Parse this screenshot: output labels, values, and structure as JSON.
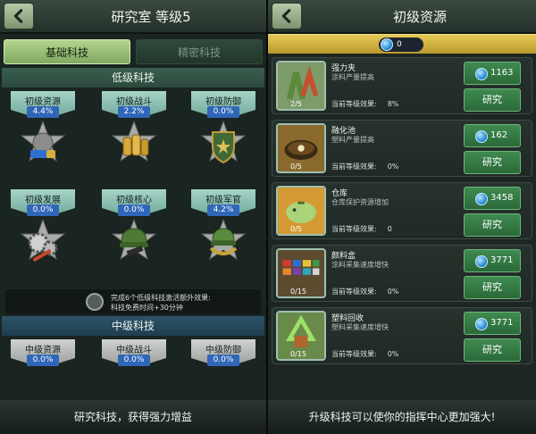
{
  "left": {
    "title": "研究室 等级5",
    "tabs": [
      "基础科技",
      "精密科技"
    ],
    "sections": {
      "basic": "低级科技",
      "mid": "中级科技"
    },
    "basic_techs": [
      {
        "name": "初级资源",
        "pct": "4.4%",
        "icon": "battery-medal-icon"
      },
      {
        "name": "初级战斗",
        "pct": "2.2%",
        "icon": "ammo-medal-icon"
      },
      {
        "name": "初级防御",
        "pct": "0.0%",
        "icon": "shield-medal-icon"
      },
      {
        "name": "初级发展",
        "pct": "0.0%",
        "icon": "gears-medal-icon"
      },
      {
        "name": "初级核心",
        "pct": "0.0%",
        "icon": "helmet-medal-icon"
      },
      {
        "name": "初级军官",
        "pct": "4.2%",
        "icon": "officer-helmet-medal-icon"
      }
    ],
    "mid_techs": [
      {
        "name": "中级资源",
        "pct": "0.0%"
      },
      {
        "name": "中级战斗",
        "pct": "0.0%"
      },
      {
        "name": "中级防御",
        "pct": "0.0%"
      }
    ],
    "bonus": {
      "line1": "完成6个低级科技激活额外效果:",
      "line2": "科技免费时间+30分钟"
    },
    "footer": "研究科技，获得强力增益"
  },
  "right": {
    "title": "初级资源",
    "resource_amount": "0",
    "effect_prefix": "当前等级效果:",
    "research_label": "研究",
    "cards": [
      {
        "name": "强力夹",
        "desc": "涂料产量提高",
        "level": "2/5",
        "effect": "8%",
        "cost": "1163",
        "icon": "clamp-icon"
      },
      {
        "name": "融化池",
        "desc": "塑料产量提高",
        "level": "0/5",
        "effect": "0%",
        "cost": "162",
        "icon": "melting-pot-icon"
      },
      {
        "name": "仓库",
        "desc": "仓库保护资源增加",
        "level": "0/5",
        "effect": "0",
        "cost": "3458",
        "icon": "piggy-bank-icon"
      },
      {
        "name": "颜料盒",
        "desc": "涂料采集速度增快",
        "level": "0/15",
        "effect": "0%",
        "cost": "3771",
        "icon": "paint-box-icon"
      },
      {
        "name": "塑料回收",
        "desc": "塑料采集速度增快",
        "level": "0/15",
        "effect": "0%",
        "cost": "3771",
        "icon": "recycle-icon"
      }
    ],
    "footer": "升级科技可以使你的指挥中心更加强大!"
  },
  "colors": {
    "accent_green": "#7fa860",
    "gold_bar": "#e6c957",
    "button_green": "#3f8a50",
    "pct_badge": "#2f66b8"
  }
}
